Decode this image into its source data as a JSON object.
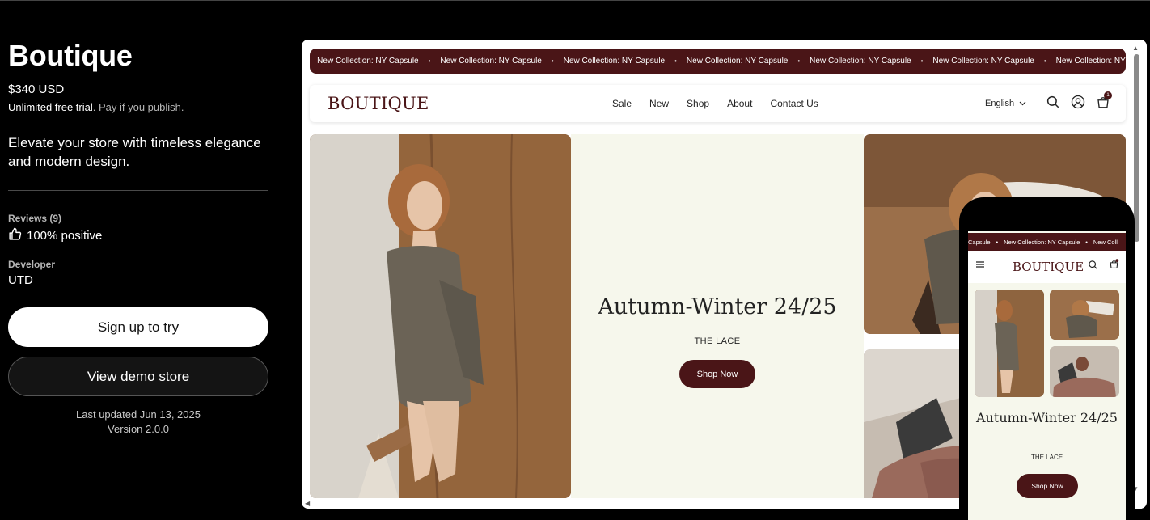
{
  "app": {
    "title": "Boutique",
    "price": "$340 USD",
    "trial_link": "Unlimited free trial",
    "trial_suffix": ". Pay if you publish.",
    "description": "Elevate your store with timeless elegance and modern design.",
    "reviews_label": "Reviews (9)",
    "reviews_positive": "100% positive",
    "developer_label": "Developer",
    "developer_name": "UTD",
    "signup_label": "Sign up to try",
    "demo_label": "View demo store",
    "last_updated": "Last updated Jun 13, 2025",
    "version": "Version 2.0.0"
  },
  "preview": {
    "announcement_partial": "sule",
    "announcement": "New Collection: NY Capsule",
    "announcement_cut": "New Collection: NY Cap",
    "logo": "BOUTIQUE",
    "nav": [
      "Sale",
      "New",
      "Shop",
      "About",
      "Contact Us"
    ],
    "language": "English",
    "cart_count": "1",
    "hero_title": "Autumn-Winter 24/25",
    "hero_subtitle": "THE LACE",
    "hero_button": "Shop Now"
  },
  "mobile": {
    "announcement_partial": "Capsule",
    "announcement": "New Collection: NY Capsule",
    "announcement_cut": "New Coll",
    "logo": "BOUTIQUE",
    "hero_title": "Autumn-Winter 24/25",
    "hero_subtitle": "THE LACE",
    "hero_button": "Shop Now"
  },
  "colors": {
    "brand": "#4a1517",
    "hero_bg": "#f6f7ec",
    "page_bg": "#000000"
  }
}
